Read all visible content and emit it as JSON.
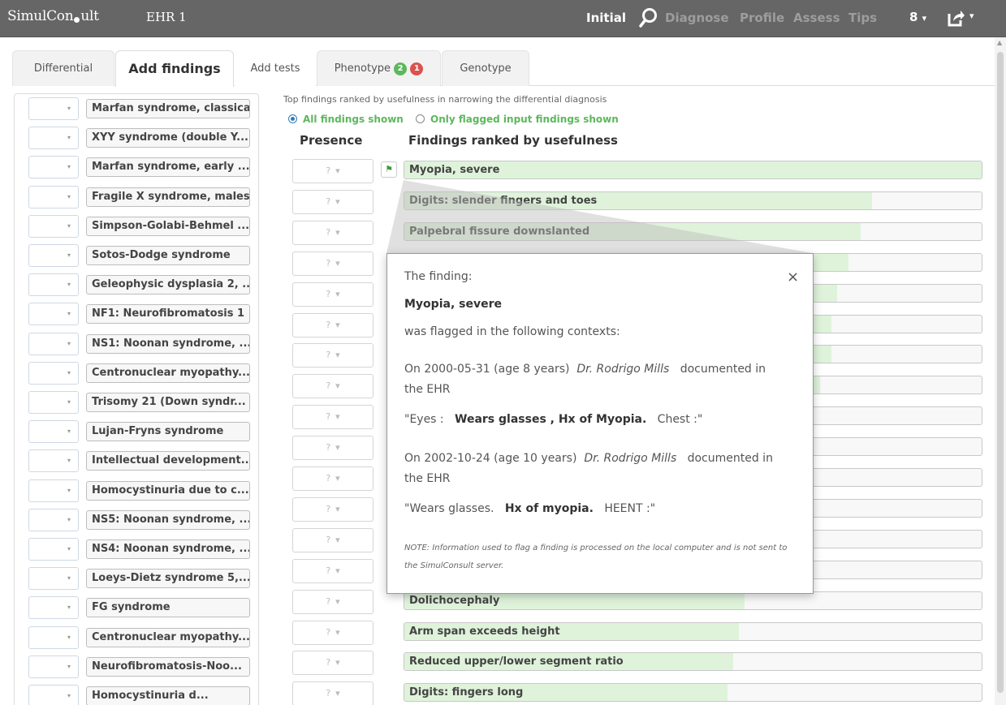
{
  "app": {
    "logo_pre": "SimulCon",
    "logo_post": "ult",
    "ehr_label": "EHR 1"
  },
  "nav": {
    "initial": "Initial",
    "diagnose": "Diagnose",
    "profile": "Profile",
    "assess": "Assess",
    "tips": "Tips",
    "help_glyph": "8",
    "caret": "▾"
  },
  "tabs": {
    "differential": "Differential",
    "add_findings": "Add findings",
    "add_tests": "Add tests",
    "phenotype": "Phenotype",
    "phenotype_badge_green": "2",
    "phenotype_badge_red": "1",
    "genotype": "Genotype"
  },
  "colors": {
    "badge_green": "#5cb85c",
    "badge_red": "#d9534f",
    "bar_fill": "#dff3db",
    "topbar": "#666666"
  },
  "sidebar": {
    "items": [
      "Marfan syndrome, classical",
      "XYY syndrome (double Y...",
      "Marfan syndrome, early ...",
      "Fragile X syndrome, males",
      "Simpson-Golabi-Behmel ...",
      "Sotos-Dodge syndrome",
      "Geleophysic dysplasia 2, ...",
      "NF1: Neurofibromatosis 1",
      "NS1: Noonan syndrome, ...",
      "Centronuclear myopathy...",
      "Trisomy 21 (Down syndr...",
      "Lujan-Fryns syndrome",
      "Intellectual development...",
      "Homocystinuria due to c...",
      "NS5: Noonan syndrome, ...",
      "NS4: Noonan syndrome, ...",
      "Loeys-Dietz syndrome 5,...",
      "FG syndrome",
      "Centronuclear myopathy...",
      "Neurofibromatosis-Noo...",
      "Homocystinuria d..."
    ]
  },
  "main": {
    "hint": "Top findings ranked by usefulness in narrowing the differential diagnosis",
    "radio_all": "All findings shown",
    "radio_flagged": "Only flagged input findings shown",
    "col_presence": "Presence",
    "col_findings": "Findings ranked by usefulness",
    "presence_value": "?",
    "presence_caret": "▾"
  },
  "findings": [
    {
      "label": "Myopia, severe",
      "usefulness": 1.0
    },
    {
      "label": "Digits: slender fingers and toes",
      "usefulness": 0.81
    },
    {
      "label": "Palpebral fissure downslanted",
      "usefulness": 0.79
    },
    {
      "label": "",
      "usefulness": 0.77
    },
    {
      "label": "",
      "usefulness": 0.75
    },
    {
      "label": "",
      "usefulness": 0.74
    },
    {
      "label": "",
      "usefulness": 0.74
    },
    {
      "label": "",
      "usefulness": 0.72
    },
    {
      "label": "",
      "usefulness": 0.0
    },
    {
      "label": "",
      "usefulness": 0.0
    },
    {
      "label": "",
      "usefulness": 0.0
    },
    {
      "label": "",
      "usefulness": 0.0
    },
    {
      "label": "",
      "usefulness": 0.0
    },
    {
      "label": "",
      "usefulness": 0.0
    },
    {
      "label": "Dolichocephaly",
      "usefulness": 0.59
    },
    {
      "label": "Arm span exceeds height",
      "usefulness": 0.58
    },
    {
      "label": "Reduced upper/lower segment ratio",
      "usefulness": 0.57
    },
    {
      "label": "Digits: fingers long",
      "usefulness": 0.56
    }
  ],
  "popup": {
    "close": "×",
    "intro": "The finding:",
    "finding": "Myopia, severe",
    "flagged_text": "was flagged in the following contexts:",
    "entry1_pre": "On 2000-05-31 (age 8 years)",
    "entry1_doc": "Dr. Rodrigo Mills",
    "entry1_post": "documented in",
    "entry1_tail": "the EHR",
    "quote1_a": "\"Eyes :",
    "quote1_b": "Wears glasses , Hx of Myopia.",
    "quote1_c": "Chest :\"",
    "entry2_pre": "On 2002-10-24 (age 10 years)",
    "entry2_doc": "Dr. Rodrigo Mills",
    "entry2_post": "documented in",
    "entry2_tail": "the EHR",
    "quote2_a": "\"Wears glasses.",
    "quote2_b": "Hx of myopia.",
    "quote2_c": "HEENT :\"",
    "note": "NOTE: Information used to flag a finding is processed on the local computer and is not sent to the SimulConsult server."
  }
}
